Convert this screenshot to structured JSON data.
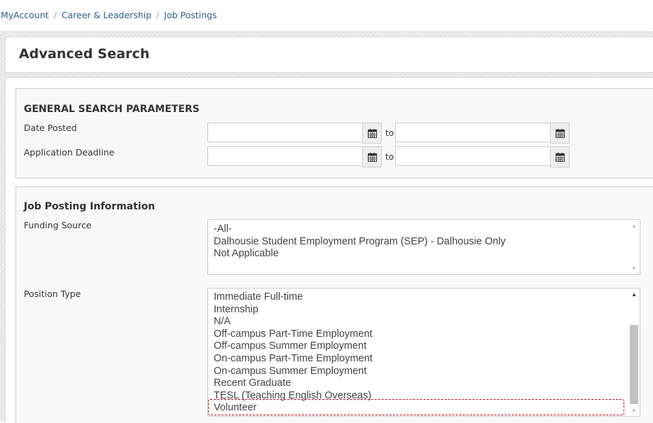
{
  "breadcrumb": {
    "items": [
      "MyAccount",
      "Career & Leadership",
      "Job Postings"
    ],
    "separator": "/"
  },
  "page": {
    "title": "Advanced Search"
  },
  "general": {
    "heading": "GENERAL SEARCH PARAMETERS",
    "date_posted": {
      "label": "Date Posted",
      "from": "",
      "to": "",
      "to_label": "to"
    },
    "application_deadline": {
      "label": "Application Deadline",
      "from": "",
      "to": "",
      "to_label": "to"
    },
    "icon": "calendar-icon"
  },
  "job_info": {
    "heading": "Job Posting Information",
    "funding_source": {
      "label": "Funding Source",
      "options": [
        "-All-",
        "Dalhousie Student Employment Program (SEP) - Dalhousie Only",
        "Not Applicable"
      ]
    },
    "position_type": {
      "label": "Position Type",
      "options": [
        "Immediate Full-time",
        "Internship",
        "N/A",
        "Off-campus Part-Time Employment",
        "Off-campus Summer Employment",
        "On-campus Part-Time Employment",
        "On-campus Summer Employment",
        "Recent Graduate",
        "TESL (Teaching English Overseas)",
        "Volunteer"
      ],
      "highlighted_option": "Volunteer"
    }
  },
  "colors": {
    "link": "#2a5d8c",
    "highlight_border": "#cc0000",
    "panel_bg": "#f8f8f8"
  }
}
